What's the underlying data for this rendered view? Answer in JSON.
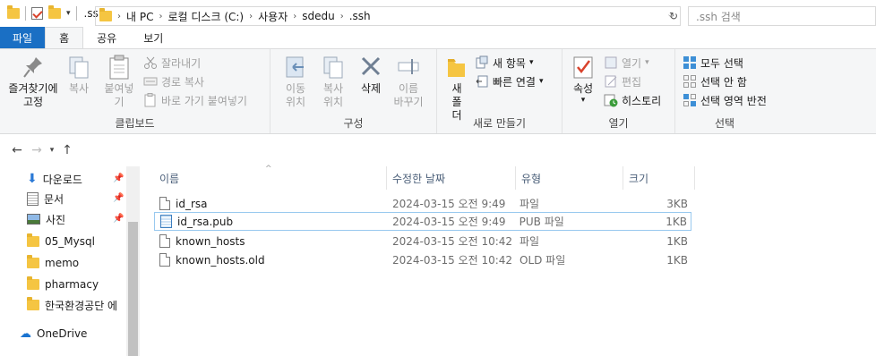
{
  "window": {
    "title": ".ssh"
  },
  "tabs": [
    {
      "label": "파일"
    },
    {
      "label": "홈"
    },
    {
      "label": "공유"
    },
    {
      "label": "보기"
    }
  ],
  "ribbon": {
    "clipboard": {
      "pin_label": "즐겨찾기에\n고정",
      "copy_label": "복사",
      "paste_label": "붙여넣기",
      "cut_label": "잘라내기",
      "copy_path_label": "경로 복사",
      "paste_shortcut_label": "바로 가기 붙여넣기",
      "group_label": "클립보드"
    },
    "organize": {
      "move_label": "이동\n위치",
      "copyto_label": "복사\n위치",
      "delete_label": "삭제",
      "rename_label": "이름\n바꾸기",
      "group_label": "구성"
    },
    "new": {
      "new_folder_label": "새\n폴더",
      "new_item_label": "새 항목",
      "easy_access_label": "빠른 연결",
      "group_label": "새로 만들기"
    },
    "open": {
      "properties_label": "속성",
      "open_label": "열기",
      "edit_label": "편집",
      "history_label": "히스토리",
      "group_label": "열기"
    },
    "select": {
      "select_all_label": "모두 선택",
      "select_none_label": "선택 안 함",
      "invert_label": "선택 영역 반전",
      "group_label": "선택"
    }
  },
  "address": {
    "crumbs": [
      "내 PC",
      "로컬 디스크 (C:)",
      "사용자",
      "sdedu",
      ".ssh"
    ],
    "search_placeholder": ".ssh 검색"
  },
  "navpane": {
    "items": [
      {
        "label": "다운로드",
        "icon": "download-icon",
        "pinned": true
      },
      {
        "label": "문서",
        "icon": "document-icon",
        "pinned": true
      },
      {
        "label": "사진",
        "icon": "picture-icon",
        "pinned": true
      },
      {
        "label": "05_Mysql",
        "icon": "folder-icon"
      },
      {
        "label": "memo",
        "icon": "folder-icon"
      },
      {
        "label": "pharmacy",
        "icon": "folder-icon"
      },
      {
        "label": "한국환경공단 에",
        "icon": "folder-icon"
      },
      {
        "label": "OneDrive",
        "icon": "cloud-icon"
      }
    ]
  },
  "filelist": {
    "columns": [
      "이름",
      "수정한 날짜",
      "유형",
      "크기"
    ],
    "rows": [
      {
        "name": "id_rsa",
        "date": "2024-03-15 오전 9:49",
        "type": "파일",
        "size": "3KB"
      },
      {
        "name": "id_rsa.pub",
        "date": "2024-03-15 오전 9:49",
        "type": "PUB 파일",
        "size": "1KB"
      },
      {
        "name": "known_hosts",
        "date": "2024-03-15 오전 10:42",
        "type": "파일",
        "size": "1KB"
      },
      {
        "name": "known_hosts.old",
        "date": "2024-03-15 오전 10:42",
        "type": "OLD 파일",
        "size": "1KB"
      }
    ]
  },
  "colors": {
    "file_tab": "#1a6fc4",
    "selection_border": "#99c9ef",
    "folder": "#f5c542"
  }
}
